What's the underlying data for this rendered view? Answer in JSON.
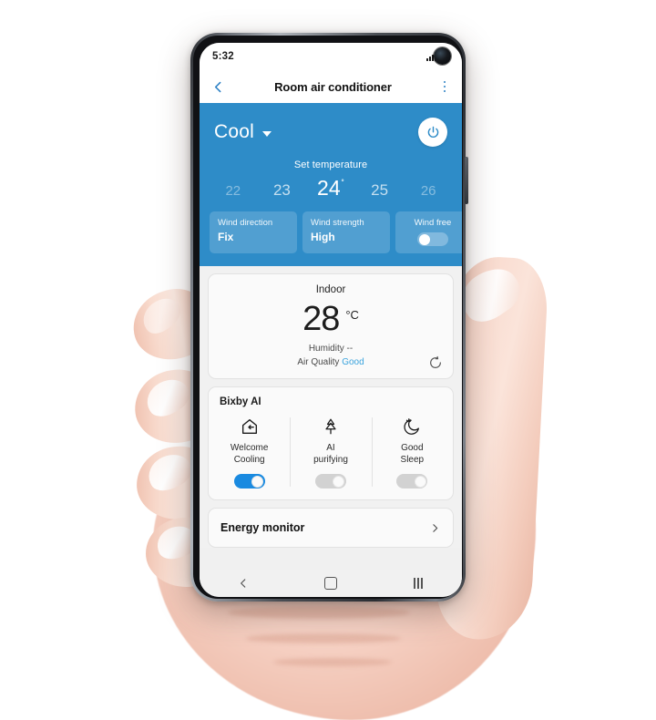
{
  "phone": {
    "status_bar": {
      "clock": "5:32",
      "icons": [
        "signal-icon",
        "battery-icon",
        "front-camera-hole"
      ]
    },
    "app_bar": {
      "back_icon": "back-chevron-icon",
      "title": "Room air conditioner",
      "menu_icon": "kebab-menu-icon"
    },
    "nav_bar": {
      "back": "nav-back-icon",
      "home": "nav-home-icon",
      "recents": "nav-recents-icon"
    }
  },
  "hero": {
    "mode": "Cool",
    "mode_caret_icon": "chevron-down-icon",
    "power_icon": "power-icon",
    "set_temperature_label": "Set temperature",
    "temperatures": [
      {
        "value": "22",
        "state": "far"
      },
      {
        "value": "23",
        "state": "near"
      },
      {
        "value": "24",
        "state": "selected",
        "degree": "˚"
      },
      {
        "value": "25",
        "state": "near"
      },
      {
        "value": "26",
        "state": "far"
      }
    ],
    "selected_temperature": "24",
    "accent_color": "#2e8cc8",
    "chips": [
      {
        "label": "Wind direction",
        "value": "Fix",
        "type": "value"
      },
      {
        "label": "Wind strength",
        "value": "High",
        "type": "value"
      },
      {
        "label": "Wind free",
        "value": "",
        "type": "toggle",
        "on": false
      }
    ]
  },
  "indoor": {
    "title": "Indoor",
    "temperature": "28",
    "unit": "°C",
    "humidity": "Humidity --",
    "air_quality_label": "Air Quality ",
    "air_quality_value": "Good",
    "air_quality_color": "#3aa3dd",
    "refresh_icon": "refresh-icon"
  },
  "bixby": {
    "title": "Bixby AI",
    "items": [
      {
        "icon": "home-arrow-in-icon",
        "label_line1": "Welcome",
        "label_line2": "Cooling",
        "toggle_on": true
      },
      {
        "icon": "tree-purify-icon",
        "label_line1": "AI",
        "label_line2": "purifying",
        "toggle_on": false
      },
      {
        "icon": "moon-sleep-icon",
        "label_line1": "Good",
        "label_line2": "Sleep",
        "toggle_on": false
      }
    ],
    "toggle_on_color": "#1a8ae0",
    "toggle_off_color": "#d2d2d2"
  },
  "energy": {
    "label": "Energy monitor",
    "chevron_icon": "chevron-right-icon"
  }
}
